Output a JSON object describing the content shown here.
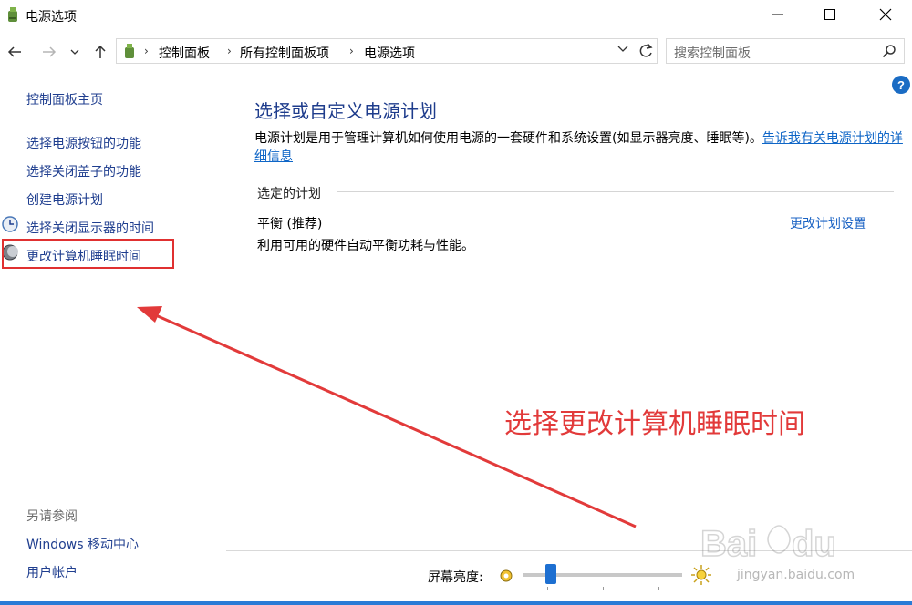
{
  "window": {
    "title": "电源选项"
  },
  "address_bar": {
    "breadcrumbs": [
      "控制面板",
      "所有控制面板项",
      "电源选项"
    ]
  },
  "search": {
    "placeholder": "搜索控制面板"
  },
  "left_nav": {
    "home": "控制面板主页",
    "items": [
      {
        "label": "选择电源按钮的功能"
      },
      {
        "label": "选择关闭盖子的功能"
      },
      {
        "label": "创建电源计划"
      },
      {
        "label": "选择关闭显示器的时间"
      },
      {
        "label": "更改计算机睡眠时间"
      }
    ],
    "see_also_heading": "另请参阅",
    "see_also": [
      {
        "label": "Windows 移动中心"
      },
      {
        "label": "用户帐户"
      }
    ]
  },
  "main": {
    "title": "选择或自定义电源计划",
    "description": "电源计划是用于管理计算机如何使用电源的一套硬件和系统设置(如显示器亮度、睡眠等)。",
    "description_link": "告诉我有关电源计划的详细信息",
    "section_label": "选定的计划",
    "plan_name": "平衡 (推荐)",
    "plan_description": "利用可用的硬件自动平衡功耗与性能。",
    "plan_link": "更改计划设置"
  },
  "annotation": {
    "text": "选择更改计算机睡眠时间",
    "color": "#e23a3a"
  },
  "brightness": {
    "label": "屏幕亮度:",
    "level": 0.17
  },
  "watermark": {
    "text": "jingyan.baidu.com"
  },
  "colors": {
    "nav_link": "#1f3e8f",
    "title_blue": "#1e3c8c",
    "link_blue": "#1b63c4",
    "highlight": "#e03030"
  }
}
